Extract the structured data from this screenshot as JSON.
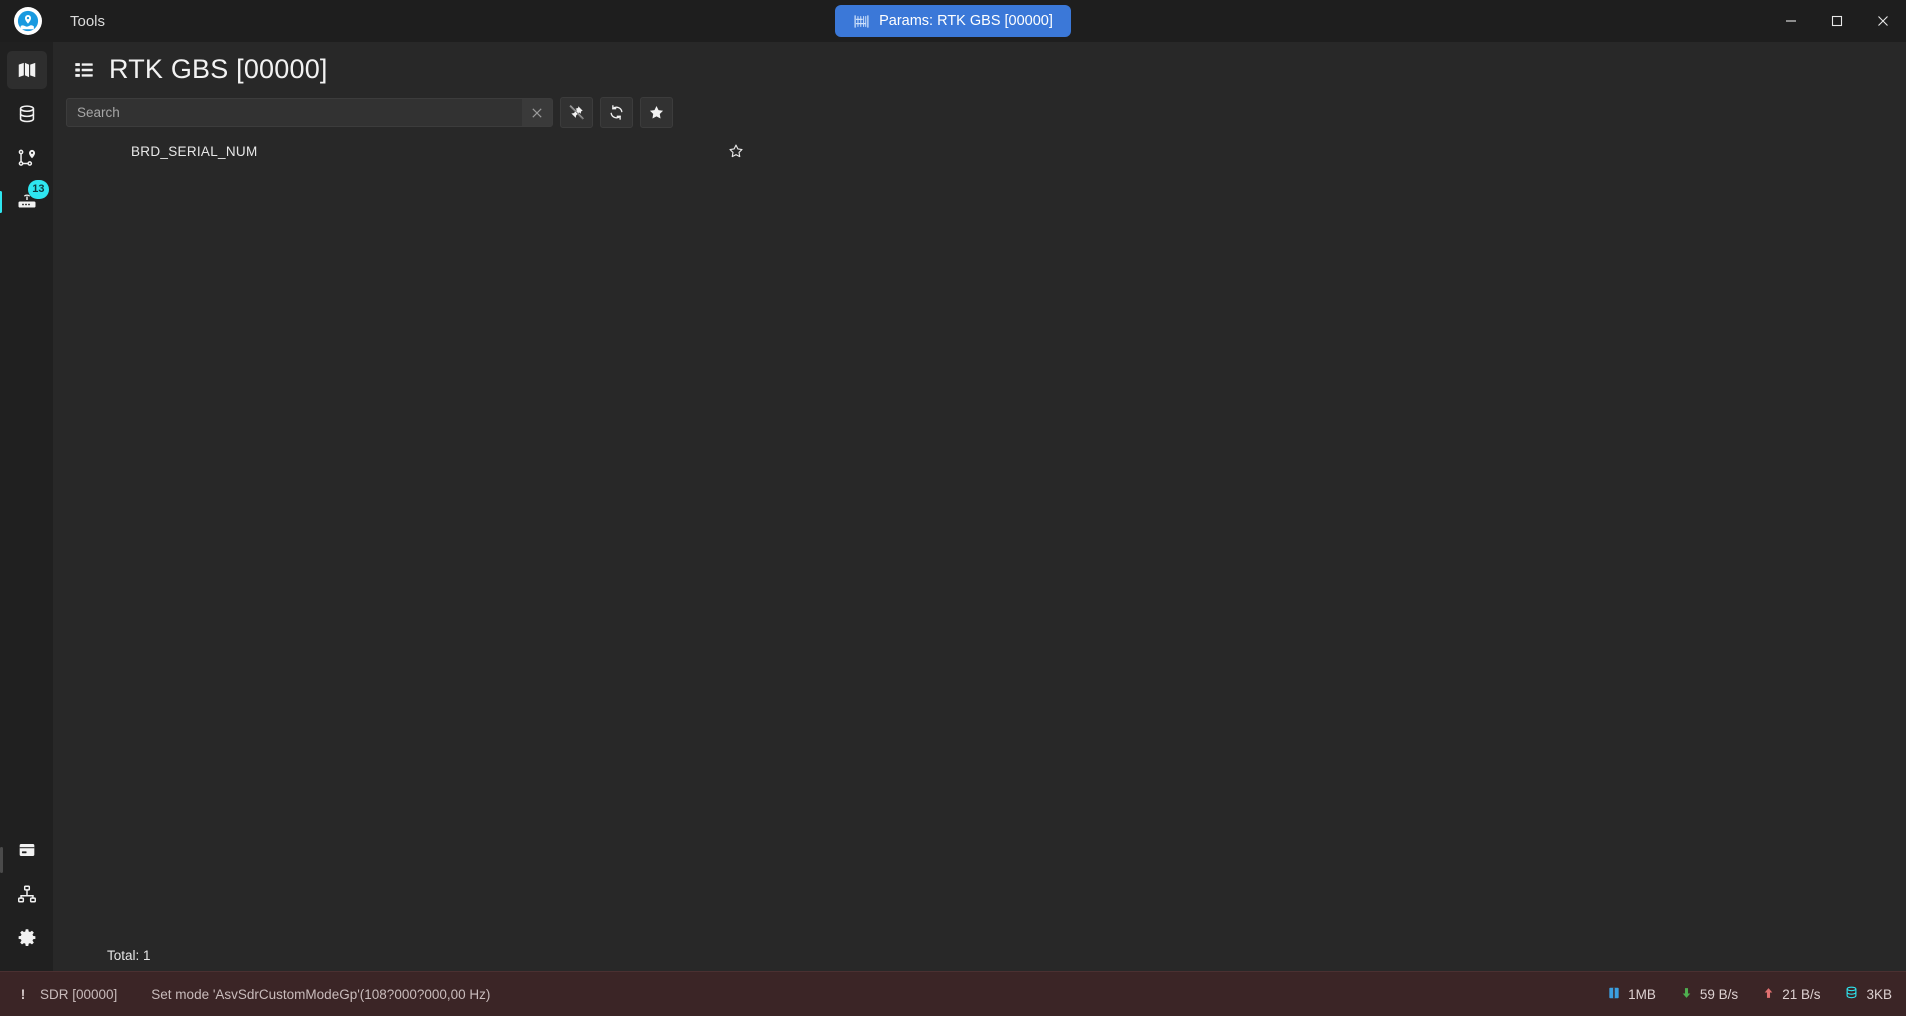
{
  "window": {
    "app_logo_icon": "map-pin-logo-icon",
    "menu": [
      {
        "label": "Tools",
        "name": "menu-tools"
      }
    ],
    "tabs": [
      {
        "label": "Params: RTK GBS [00000]",
        "icon": "sliders-params-icon",
        "active": true,
        "accent_color": "#3b78d8"
      }
    ],
    "controls": {
      "minimize": "minimize-icon",
      "maximize": "maximize-icon",
      "close": "close-icon"
    }
  },
  "sidebar": {
    "top_items": [
      {
        "name": "sidebar-item-map",
        "icon": "map-icon",
        "selected": true,
        "badge": ""
      },
      {
        "name": "sidebar-item-database",
        "icon": "database-icon",
        "selected": false,
        "badge": ""
      },
      {
        "name": "sidebar-item-routes",
        "icon": "route-waypoints-icon",
        "selected": false,
        "badge": ""
      },
      {
        "name": "sidebar-item-devices",
        "icon": "router-device-icon",
        "selected": false,
        "badge": "13"
      }
    ],
    "bottom_items": [
      {
        "name": "sidebar-item-console",
        "icon": "console-icon"
      },
      {
        "name": "sidebar-item-network",
        "icon": "network-hierarchy-icon"
      },
      {
        "name": "sidebar-item-settings",
        "icon": "gear-icon"
      },
      {
        "name": "sidebar-item-logbook",
        "icon": "notebook-icon"
      }
    ],
    "accent_color": "#2ee6f0"
  },
  "page": {
    "title": "RTK GBS [00000]",
    "title_icon": "list-icon"
  },
  "search": {
    "value": "",
    "placeholder": "Search",
    "clear_label": "✕"
  },
  "toolbar_buttons": [
    {
      "name": "pin-off-button",
      "icon": "pin-off-icon"
    },
    {
      "name": "refresh-button",
      "icon": "refresh-sync-icon"
    },
    {
      "name": "favorites-filter-button",
      "icon": "star-filled-icon"
    }
  ],
  "list": {
    "rows": [
      {
        "label": "BRD_SERIAL_NUM",
        "favorite": false,
        "fav_icon": "star-outline-icon"
      }
    ],
    "total_label": "Total: 1"
  },
  "statusbar": {
    "severity_icon": "!",
    "source": "SDR [00000]",
    "message": "Set mode 'AsvSdrCustomModeGp'(108?000?000,00 Hz)",
    "background_color": "#3b2526",
    "metrics": [
      {
        "name": "memory-usage",
        "icon": "book-memory-icon",
        "icon_color": "#3b9fe0",
        "value": "1MB"
      },
      {
        "name": "download-rate",
        "icon": "arrow-down-icon",
        "icon_color": "#4fae4f",
        "value": "59 B/s"
      },
      {
        "name": "upload-rate",
        "icon": "arrow-up-icon",
        "icon_color": "#e07070",
        "value": "21 B/s"
      },
      {
        "name": "storage-size",
        "icon": "database-small-icon",
        "icon_color": "#2ee6f0",
        "value": "3KB"
      }
    ]
  }
}
